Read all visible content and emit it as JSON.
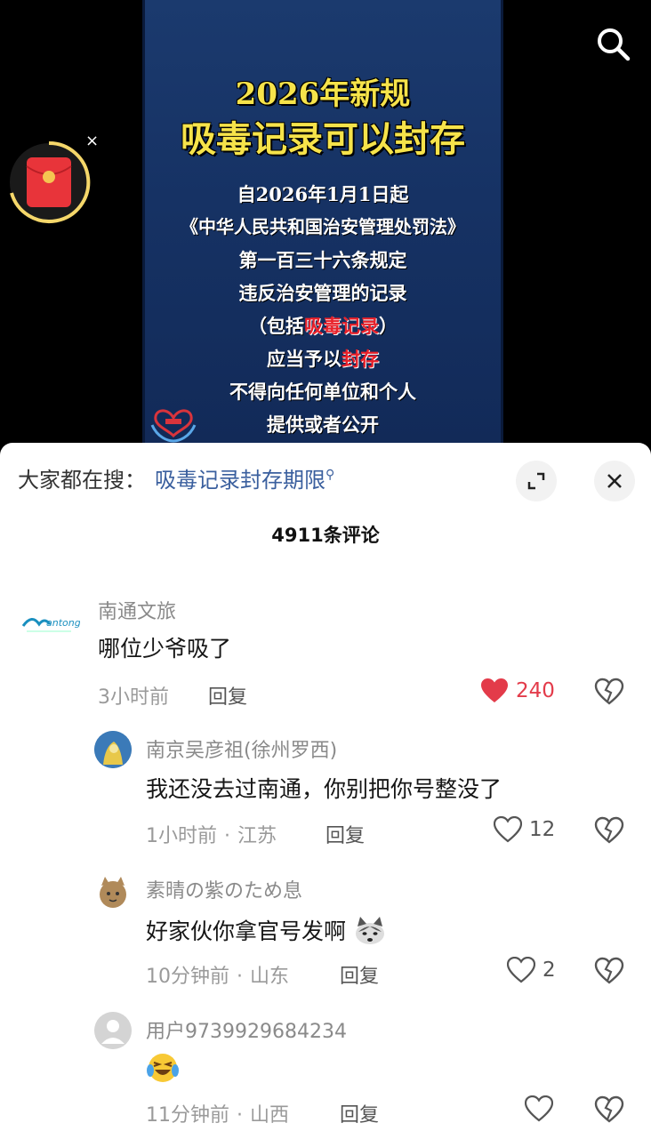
{
  "video": {
    "poster_title_1": "2026年新规",
    "poster_title_2": "吸毒记录可以封存",
    "poster_lines": [
      "自2026年1月1日起",
      "《中华人民共和国治安管理处罚法》",
      "第一百三十六条规定",
      "违反治安管理的记录"
    ],
    "line5_pre": "（包括",
    "line5_hl": "吸毒记录",
    "line5_post": "）",
    "line6_pre": "应当予以",
    "line6_hl": "封存",
    "line7": "不得向任何单位和个人",
    "line8": "提供或者公开",
    "close_label": "×"
  },
  "panel": {
    "hot_label": "大家都在搜：",
    "hot_keyword": "吸毒记录封存期限",
    "comment_count": "4911条评论"
  },
  "comments": [
    {
      "user": "南通文旅",
      "text": "哪位少爷吸了",
      "time": "3小时前",
      "location": "",
      "reply": "回复",
      "likes": "240",
      "liked": true
    },
    {
      "user": "南京吴彦祖(徐州罗西)",
      "text": "我还没去过南通，你别把你号整没了",
      "time": "1小时前",
      "location": "江苏",
      "reply": "回复",
      "likes": "12",
      "liked": false
    },
    {
      "user": "素晴の紫のため息",
      "text": "好家伙你拿官号发啊",
      "time": "10分钟前",
      "location": "山东",
      "reply": "回复",
      "likes": "2",
      "liked": false
    },
    {
      "user": "用户9739929684234",
      "text": "",
      "time": "11分钟前",
      "location": "山西",
      "reply": "回复",
      "likes": "",
      "liked": false
    }
  ],
  "icons": {
    "search": "search-icon",
    "red_packet": "red-envelope-icon",
    "expand": "expand-icon",
    "close": "close-icon",
    "like": "heart-icon",
    "dislike": "broken-heart-icon"
  },
  "colors": {
    "poster_bg": "#1b3a6e",
    "poster_title": "#f6e34a",
    "highlight": "#e8212a",
    "like_active": "#e33b4a",
    "keyword": "#3a5f9e"
  }
}
